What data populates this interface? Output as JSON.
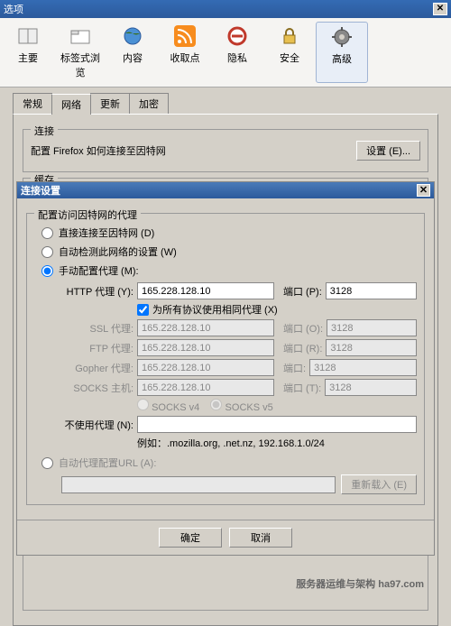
{
  "window": {
    "title": "选项"
  },
  "toolbar": {
    "items": [
      {
        "label": "主要"
      },
      {
        "label": "标签式浏览"
      },
      {
        "label": "内容"
      },
      {
        "label": "收取点"
      },
      {
        "label": "隐私"
      },
      {
        "label": "安全"
      },
      {
        "label": "高级"
      }
    ]
  },
  "tabs": {
    "items": [
      "常规",
      "网络",
      "更新",
      "加密"
    ],
    "active": 1
  },
  "connection": {
    "legend": "连接",
    "desc": "配置 Firefox 如何连接至因特网",
    "settings_btn": "设置 (E)..."
  },
  "cache": {
    "legend": "缓存"
  },
  "dialog": {
    "title": "连接设置",
    "fieldset": "配置访问因特网的代理",
    "radio_direct": "直接连接至因特网 (D)",
    "radio_auto_detect": "自动检测此网络的设置 (W)",
    "radio_manual": "手动配置代理 (M):",
    "http_label": "HTTP 代理 (Y):",
    "http_host": "165.228.128.10",
    "port_label_p": "端口 (P):",
    "http_port": "3128",
    "same_proxy": "为所有协议使用相同代理 (X)",
    "ssl_label": "SSL 代理:",
    "ftp_label": "FTP 代理:",
    "gopher_label": "Gopher 代理:",
    "socks_label": "SOCKS 主机:",
    "shared_host": "165.228.128.10",
    "port_label_o": "端口 (O):",
    "port_label_r": "端口 (R):",
    "port_label_g": "端口:",
    "port_label_t": "端口 (T):",
    "shared_port": "3128",
    "socks_v4": "SOCKS v4",
    "socks_v5": "SOCKS v5",
    "no_proxy_label": "不使用代理 (N):",
    "no_proxy_value": "",
    "example": "例如：.mozilla.org, .net.nz, 192.168.1.0/24",
    "radio_auto_url": "自动代理配置URL (A):",
    "reload_btn": "重新载入 (E)",
    "ok": "确定",
    "cancel": "取消"
  },
  "watermark": "服务器运维与架构 ha97.com"
}
